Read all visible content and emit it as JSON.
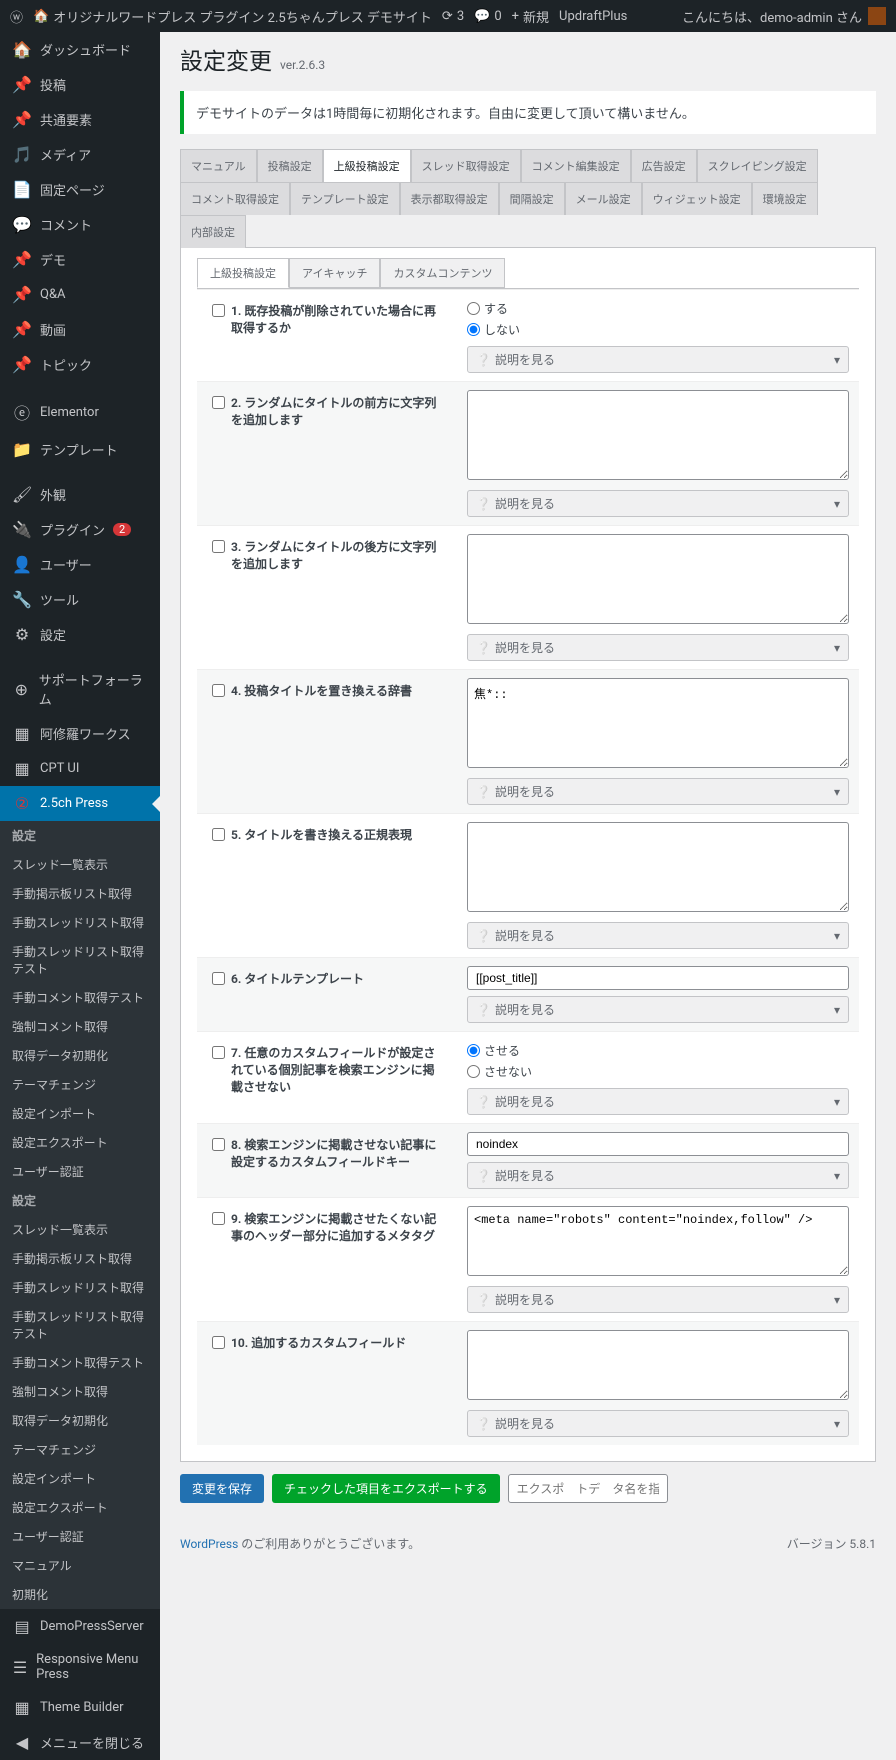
{
  "adminbar": {
    "site": "オリジナルワードプレス プラグイン 2.5ちゃんプレス デモサイト",
    "comments": "3",
    "notif": "0",
    "new": "新規",
    "updraft": "UpdraftPlus",
    "greeting": "こんにちは、demo-admin さん"
  },
  "sidebar": {
    "dashboard": "ダッシュボード",
    "posts": "投稿",
    "shared": "共通要素",
    "media": "メディア",
    "pages": "固定ページ",
    "comments": "コメント",
    "demo": "デモ",
    "qa": "Q&A",
    "video": "動画",
    "topic": "トピック",
    "elementor": "Elementor",
    "template": "テンプレート",
    "appearance": "外観",
    "plugins": "プラグイン",
    "plugins_badge": "2",
    "users": "ユーザー",
    "tools": "ツール",
    "settings": "設定",
    "support": "サポートフォーラム",
    "ashura": "阿修羅ワークス",
    "cptui": "CPT UI",
    "twofive": "2.5ch Press",
    "sub_settei": "設定",
    "sub1": "スレッド一覧表示",
    "sub2": "手動掲示板リスト取得",
    "sub3": "手動スレッドリスト取得",
    "sub4": "手動スレッドリスト取得テスト",
    "sub5": "手動コメント取得テスト",
    "sub6": "強制コメント取得",
    "sub7": "取得データ初期化",
    "sub8": "テーマチェンジ",
    "sub9": "設定インポート",
    "sub10": "設定エクスポート",
    "sub11": "ユーザー認証",
    "sub_settei2": "設定",
    "sub12": "マニュアル",
    "sub13": "初期化",
    "demopress": "DemoPressServer",
    "responsive": "Responsive Menu Press",
    "themebuilder": "Theme Builder",
    "collapse": "メニューを閉じる"
  },
  "page": {
    "title": "設定変更",
    "version": "ver.2.6.3",
    "notice": "デモサイトのデータは1時間毎に初期化されます。自由に変更して頂いて構いません。"
  },
  "tabs": {
    "main": [
      "マニュアル",
      "投稿設定",
      "上級投稿設定",
      "スレッド取得設定",
      "コメント編集設定",
      "広告設定",
      "スクレイピング設定",
      "コメント取得設定",
      "テンプレート設定",
      "表示都取得設定",
      "間隔設定",
      "メール設定",
      "ウィジェット設定",
      "環境設定",
      "内部設定"
    ],
    "inner": [
      "上級投稿設定",
      "アイキャッチ",
      "カスタムコンテンツ"
    ]
  },
  "settings": {
    "s1": {
      "label": "1. 既存投稿が削除されていた場合に再取得するか",
      "opt1": "する",
      "opt2": "しない"
    },
    "s2": {
      "label": "2. ランダムにタイトルの前方に文字列を追加します"
    },
    "s3": {
      "label": "3. ランダムにタイトルの後方に文字列を追加します"
    },
    "s4": {
      "label": "4. 投稿タイトルを置き換える辞書",
      "val": "焦*::"
    },
    "s5": {
      "label": "5. タイトルを書き換える正規表現"
    },
    "s6": {
      "label": "6. タイトルテンプレート",
      "val": "[[post_title]]"
    },
    "s7": {
      "label": "7. 任意のカスタムフィールドが設定されている個別記事を検索エンジンに掲載させない",
      "opt1": "させる",
      "opt2": "させない"
    },
    "s8": {
      "label": "8. 検索エンジンに掲載させない記事に設定するカスタムフィールドキー",
      "val": "noindex"
    },
    "s9": {
      "label": "9. 検索エンジンに掲載させたくない記事のヘッダー部分に追加するメタタグ",
      "val": "<meta name=\"robots\" content=\"noindex,follow\" />"
    },
    "s10": {
      "label": "10. 追加するカスタムフィールド"
    },
    "help": "説明を見る"
  },
  "buttons": {
    "save": "変更を保存",
    "export": "チェックした項目をエクスポートする",
    "placeholder": "エクスポ　トデ　タ名を指定できます"
  },
  "footer": {
    "wp": "WordPress",
    "thanks": " のご利用ありがとうございます。",
    "version": "バージョン 5.8.1"
  }
}
